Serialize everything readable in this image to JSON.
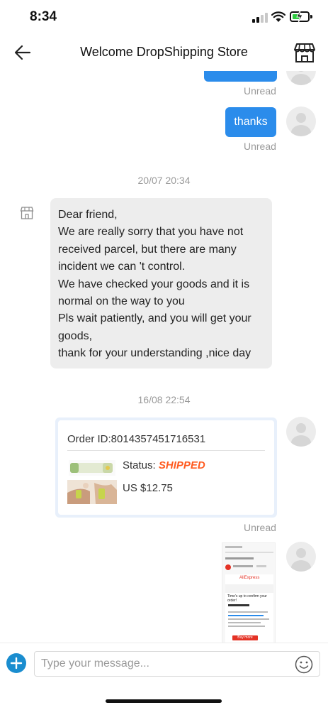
{
  "status_bar": {
    "time": "8:34"
  },
  "header": {
    "title": "Welcome DropShipping Store",
    "back_icon": "arrow-left-icon",
    "store_icon": "storefront-icon"
  },
  "messages": {
    "first_unread": "Unread",
    "thanks": {
      "text": "thanks",
      "status": "Unread"
    },
    "timestamp_1": "20/07 20:34",
    "seller_lines": [
      "Dear friend,",
      "We are really sorry that you have not",
      "received parcel, but there are many",
      "incident we can 't control.",
      "We have checked your goods  and  it is",
      "normal on the way to you",
      "Pls wait patiently,  and you will get your",
      "goods,",
      "thank for your understanding ,nice day"
    ],
    "timestamp_2": "16/08 22:54",
    "order": {
      "id_label": "Order ID:8014357451716531",
      "status_label": "Status: ",
      "status_value": "SHIPPED",
      "price": "US $12.75",
      "read_status": "Unread"
    },
    "screenshot_preview": {
      "brand": "AliExpress",
      "heading": "Time's up to confirm your order!",
      "button": "Buy more"
    }
  },
  "input": {
    "placeholder": "Type your message..."
  },
  "colors": {
    "bubble_blue": "#2b8ceb",
    "shipped_orange": "#ff5a1f",
    "add_button": "#1a8dcf"
  }
}
